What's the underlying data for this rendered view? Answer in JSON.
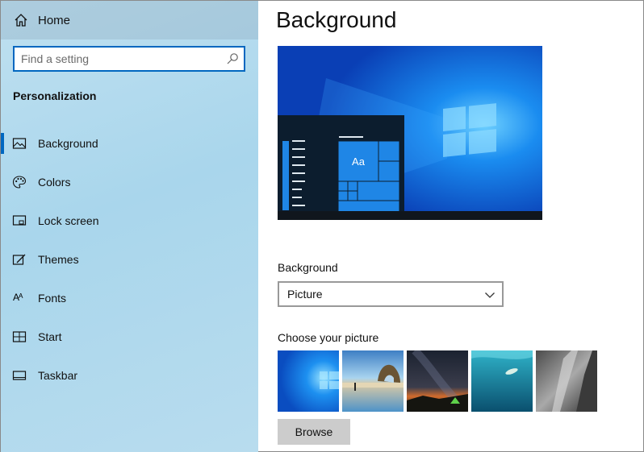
{
  "sidebar": {
    "home_label": "Home",
    "search_placeholder": "Find a setting",
    "section_title": "Personalization",
    "items": [
      {
        "label": "Background",
        "icon": "picture-icon"
      },
      {
        "label": "Colors",
        "icon": "palette-icon"
      },
      {
        "label": "Lock screen",
        "icon": "lock-screen-icon"
      },
      {
        "label": "Themes",
        "icon": "themes-icon"
      },
      {
        "label": "Fonts",
        "icon": "fonts-icon"
      },
      {
        "label": "Start",
        "icon": "start-icon"
      },
      {
        "label": "Taskbar",
        "icon": "taskbar-icon"
      }
    ],
    "active_item": "Background",
    "fonts_icon_glyph": "Aᴬ"
  },
  "main": {
    "title": "Background",
    "preview_tile_text": "Aa",
    "background_label": "Background",
    "background_value": "Picture",
    "choose_label": "Choose your picture",
    "browse_label": "Browse",
    "thumbnails": [
      "windows-hero",
      "beach-rock-arch",
      "night-sky-tent",
      "underwater-swimmer",
      "rock-cliff"
    ]
  },
  "colors": {
    "accent": "#0067c0",
    "sidebar_bg": "#a9d6ec",
    "preview_blue": "#0a5fd8"
  }
}
